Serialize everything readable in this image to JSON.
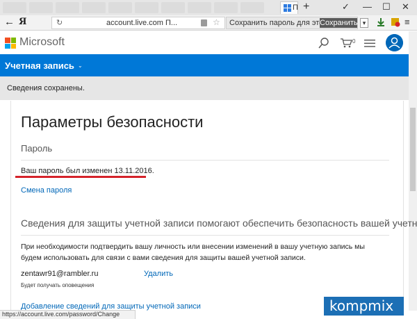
{
  "browser": {
    "active_tab_letter": "П",
    "new_tab_label": "+",
    "window_controls": [
      "✓",
      "—",
      "☐",
      "✕"
    ],
    "back_label": "←",
    "yandex_logo": "Я",
    "reload_glyph": "↻",
    "url": "account.live.com   П...",
    "star_glyph": "☆",
    "save_password_prompt": "Сохранить пароль для этог...",
    "save_button": "Сохранить",
    "dropdown_glyph": "▾",
    "menu_glyph": "≡"
  },
  "header": {
    "brand": "Microsoft",
    "logo_colors": [
      "#f25022",
      "#7fba00",
      "#00a4ef",
      "#ffb900"
    ],
    "cart_count": "0"
  },
  "account_bar": {
    "title": "Учетная запись",
    "chevron": "⌄",
    "accent": "#0078d7"
  },
  "notice": {
    "text": "Сведения сохранены."
  },
  "main": {
    "title": "Параметры безопасности",
    "password_section": "Пароль",
    "password_changed": "Ваш пароль был изменен 13.11.2016.",
    "change_password_link": "Смена пароля",
    "security_info_heading": "Сведения для защиты учетной записи помогают обеспечить безопасность вашей учетн...",
    "security_info_desc": "При необходимости подтвердить вашу личность или внесении изменений в вашу учетную запись мы будем использовать для связи с вами сведения для защиты вашей учетной записи.",
    "email": "zentawr91@rambler.ru",
    "delete_link": "Удалить",
    "notifications_note": "Будет получать оповещения",
    "add_security_info_link": "Добавление сведений для защиты учетной записи"
  },
  "statusbar": {
    "url": "https://account.live.com/password/Change"
  },
  "watermark": {
    "text": "kompmix"
  }
}
